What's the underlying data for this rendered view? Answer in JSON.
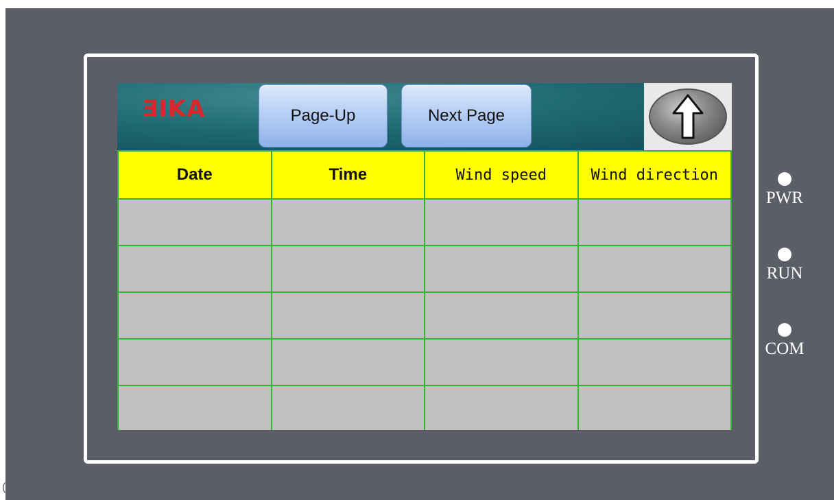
{
  "screen": {
    "header": {
      "logo": {
        "text": "RIKA",
        "brand_color": "#d8262c",
        "display": "ƎIKA"
      },
      "buttons": {
        "page_up": "Page-Up",
        "next_page": "Next Page"
      },
      "up_button_icon": "up-arrow-icon"
    },
    "table": {
      "columns": [
        "Date",
        "Time",
        "Wind speed",
        "Wind direction"
      ],
      "rows": [
        [
          "",
          "",
          "",
          ""
        ],
        [
          "",
          "",
          "",
          ""
        ],
        [
          "",
          "",
          "",
          ""
        ],
        [
          "",
          "",
          "",
          ""
        ],
        [
          "",
          "",
          "",
          ""
        ]
      ],
      "header_color": "#ffff00",
      "grid_color": "#2fb52f",
      "cell_color": "#c1c1c1"
    }
  },
  "indicators": [
    {
      "label": "PWR"
    },
    {
      "label": "RUN"
    },
    {
      "label": "COM"
    }
  ],
  "colors": {
    "device_body": "#5b5e66",
    "bezel": "#ffffff",
    "header_bg": "#1f6a73"
  }
}
